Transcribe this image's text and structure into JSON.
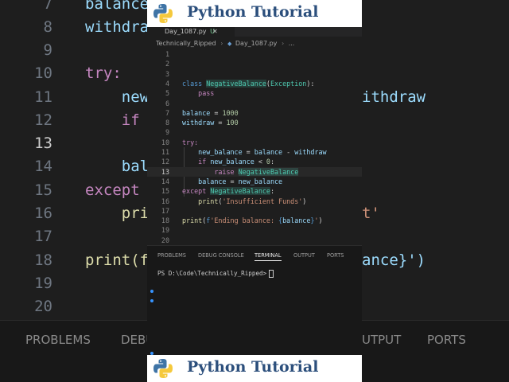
{
  "banner": {
    "title": "Python Tutorial"
  },
  "tab": {
    "filename": "Day_1087.py",
    "status": "U",
    "close": "✕"
  },
  "breadcrumb": {
    "folder": "Technically_Ripped",
    "sep": "›",
    "file": "Day_1087.py",
    "more": "..."
  },
  "panel": {
    "tabs": [
      "PROBLEMS",
      "DEBUG CONSOLE",
      "TERMINAL",
      "OUTPUT",
      "PORTS"
    ],
    "active_tab": "TERMINAL",
    "prompt": "PS D:\\Code\\Technically_Ripped>"
  },
  "background": {
    "lines": [
      {
        "num": "7",
        "code": "balance"
      },
      {
        "num": "8",
        "code": "withdra"
      },
      {
        "num": "9",
        "code": ""
      },
      {
        "num": "10",
        "code": "try:"
      },
      {
        "num": "11",
        "code": "    new"
      },
      {
        "num": "12",
        "code": "    if"
      },
      {
        "num": "13",
        "code": ""
      },
      {
        "num": "14",
        "code": "    bal"
      },
      {
        "num": "15",
        "code": "except"
      },
      {
        "num": "16",
        "code": "    pri"
      },
      {
        "num": "17",
        "code": ""
      },
      {
        "num": "18",
        "code": "print(f"
      },
      {
        "num": "19",
        "code": ""
      },
      {
        "num": "20",
        "code": ""
      }
    ],
    "right_fragments": [
      "ithdraw",
      "t'",
      "ance}')"
    ],
    "panel_tabs": [
      "PROBLEMS",
      "DEBU",
      "UTPUT",
      "PORTS"
    ]
  },
  "editor": {
    "line_numbers": [
      "1",
      "2",
      "3",
      "4",
      "5",
      "6",
      "7",
      "8",
      "9",
      "10",
      "11",
      "12",
      "13",
      "14",
      "15",
      "16",
      "17",
      "18",
      "19",
      "20"
    ],
    "active_line": "13",
    "code": {
      "l4_kw": "class",
      "l4_name": "NegativeBalance",
      "l4_open": "(",
      "l4_base": "Exception",
      "l4_close": "):",
      "l5": "pass",
      "l7_var": "balance",
      "l7_op": " = ",
      "l7_num": "1000",
      "l8_var": "withdraw",
      "l8_op": " = ",
      "l8_num": "100",
      "l10": "try:",
      "l11_var1": "new_balance",
      "l11_op": " = ",
      "l11_var2": "balance",
      "l11_minus": " - ",
      "l11_var3": "withdraw",
      "l12_kw": "if",
      "l12_var": "new_balance",
      "l12_op": " < ",
      "l12_num": "0",
      "l12_colon": ":",
      "l13_kw": "raise",
      "l13_name": "NegativeBalance",
      "l14_var1": "balance",
      "l14_op": " = ",
      "l14_var2": "new_balance",
      "l15_kw": "except",
      "l15_name": "NegativeBalance",
      "l15_colon": ":",
      "l16_fn": "print",
      "l16_open": "(",
      "l16_str": "'Insufficient Funds'",
      "l16_close": ")",
      "l18_fn": "print",
      "l18_open": "(",
      "l18_f": "f",
      "l18_str1": "'Ending balance: ",
      "l18_br1": "{",
      "l18_var": "balance",
      "l18_br2": "}",
      "l18_str2": "'",
      "l18_close": ")"
    }
  }
}
